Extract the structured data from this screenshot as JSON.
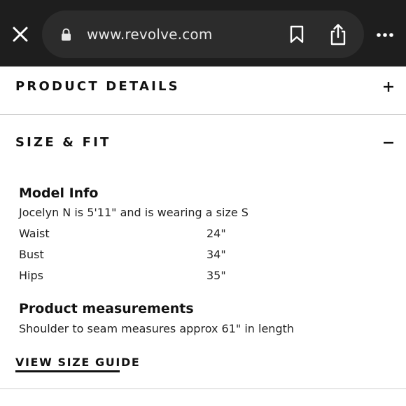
{
  "browser": {
    "url": "www.revolve.com",
    "icons": [
      "close-icon",
      "lock-icon",
      "bookmark-icon",
      "share-icon",
      "more-icon"
    ]
  },
  "accordions": {
    "product_details": {
      "title": "PRODUCT DETAILS",
      "toggle": "+"
    },
    "size_fit": {
      "title": "SIZE & FIT",
      "toggle": "−"
    }
  },
  "model_info": {
    "heading": "Model Info",
    "description": "Jocelyn N is 5'11\" and is wearing a size S",
    "measurements": [
      {
        "label": "Waist",
        "value": "24\""
      },
      {
        "label": "Bust",
        "value": "34\""
      },
      {
        "label": "Hips",
        "value": "35\""
      }
    ]
  },
  "product_measurements": {
    "heading": "Product measurements",
    "description": "Shoulder to seam measures approx 61\" in length"
  },
  "size_guide_link": "VIEW SIZE GUIDE"
}
